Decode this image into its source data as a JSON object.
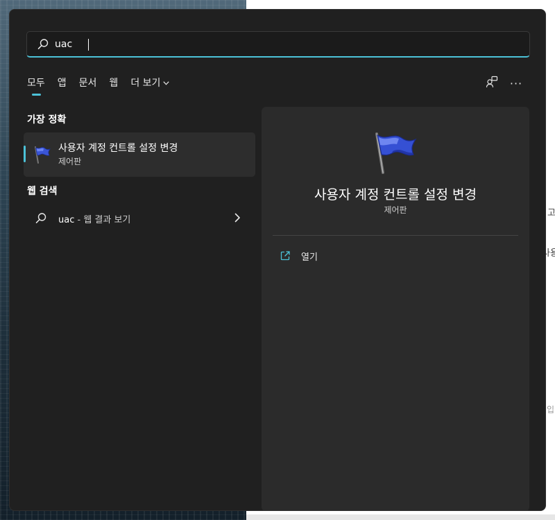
{
  "background": {
    "right_window_lines": [
      "고",
      "사용",
      "입"
    ]
  },
  "search": {
    "value": "uac",
    "placeholder": ""
  },
  "tabs": [
    {
      "label": "모두",
      "active": true
    },
    {
      "label": "앱",
      "active": false
    },
    {
      "label": "문서",
      "active": false
    },
    {
      "label": "웹",
      "active": false
    },
    {
      "label": "더 보기",
      "active": false
    }
  ],
  "toolbar": {
    "share_icon": "share-people-icon",
    "more_label": "···"
  },
  "best_match": {
    "section_title": "가장 정확",
    "name": "사용자 계정 컨트롤 설정 변경",
    "subtitle": "제어판",
    "icon": "blue-flag-icon"
  },
  "web_search": {
    "section_title": "웹 검색",
    "query": "uac",
    "suffix": " - 웹 결과 보기"
  },
  "detail": {
    "title": "사용자 계정 컨트롤 설정 변경",
    "subtitle": "제어판",
    "actions": [
      {
        "label": "열기",
        "icon": "open-external-icon"
      }
    ]
  },
  "colors": {
    "accent": "#4cc2d8",
    "panel": "#202020",
    "detail_panel": "#2b2b2b",
    "selected_item": "#2d2d2d"
  }
}
